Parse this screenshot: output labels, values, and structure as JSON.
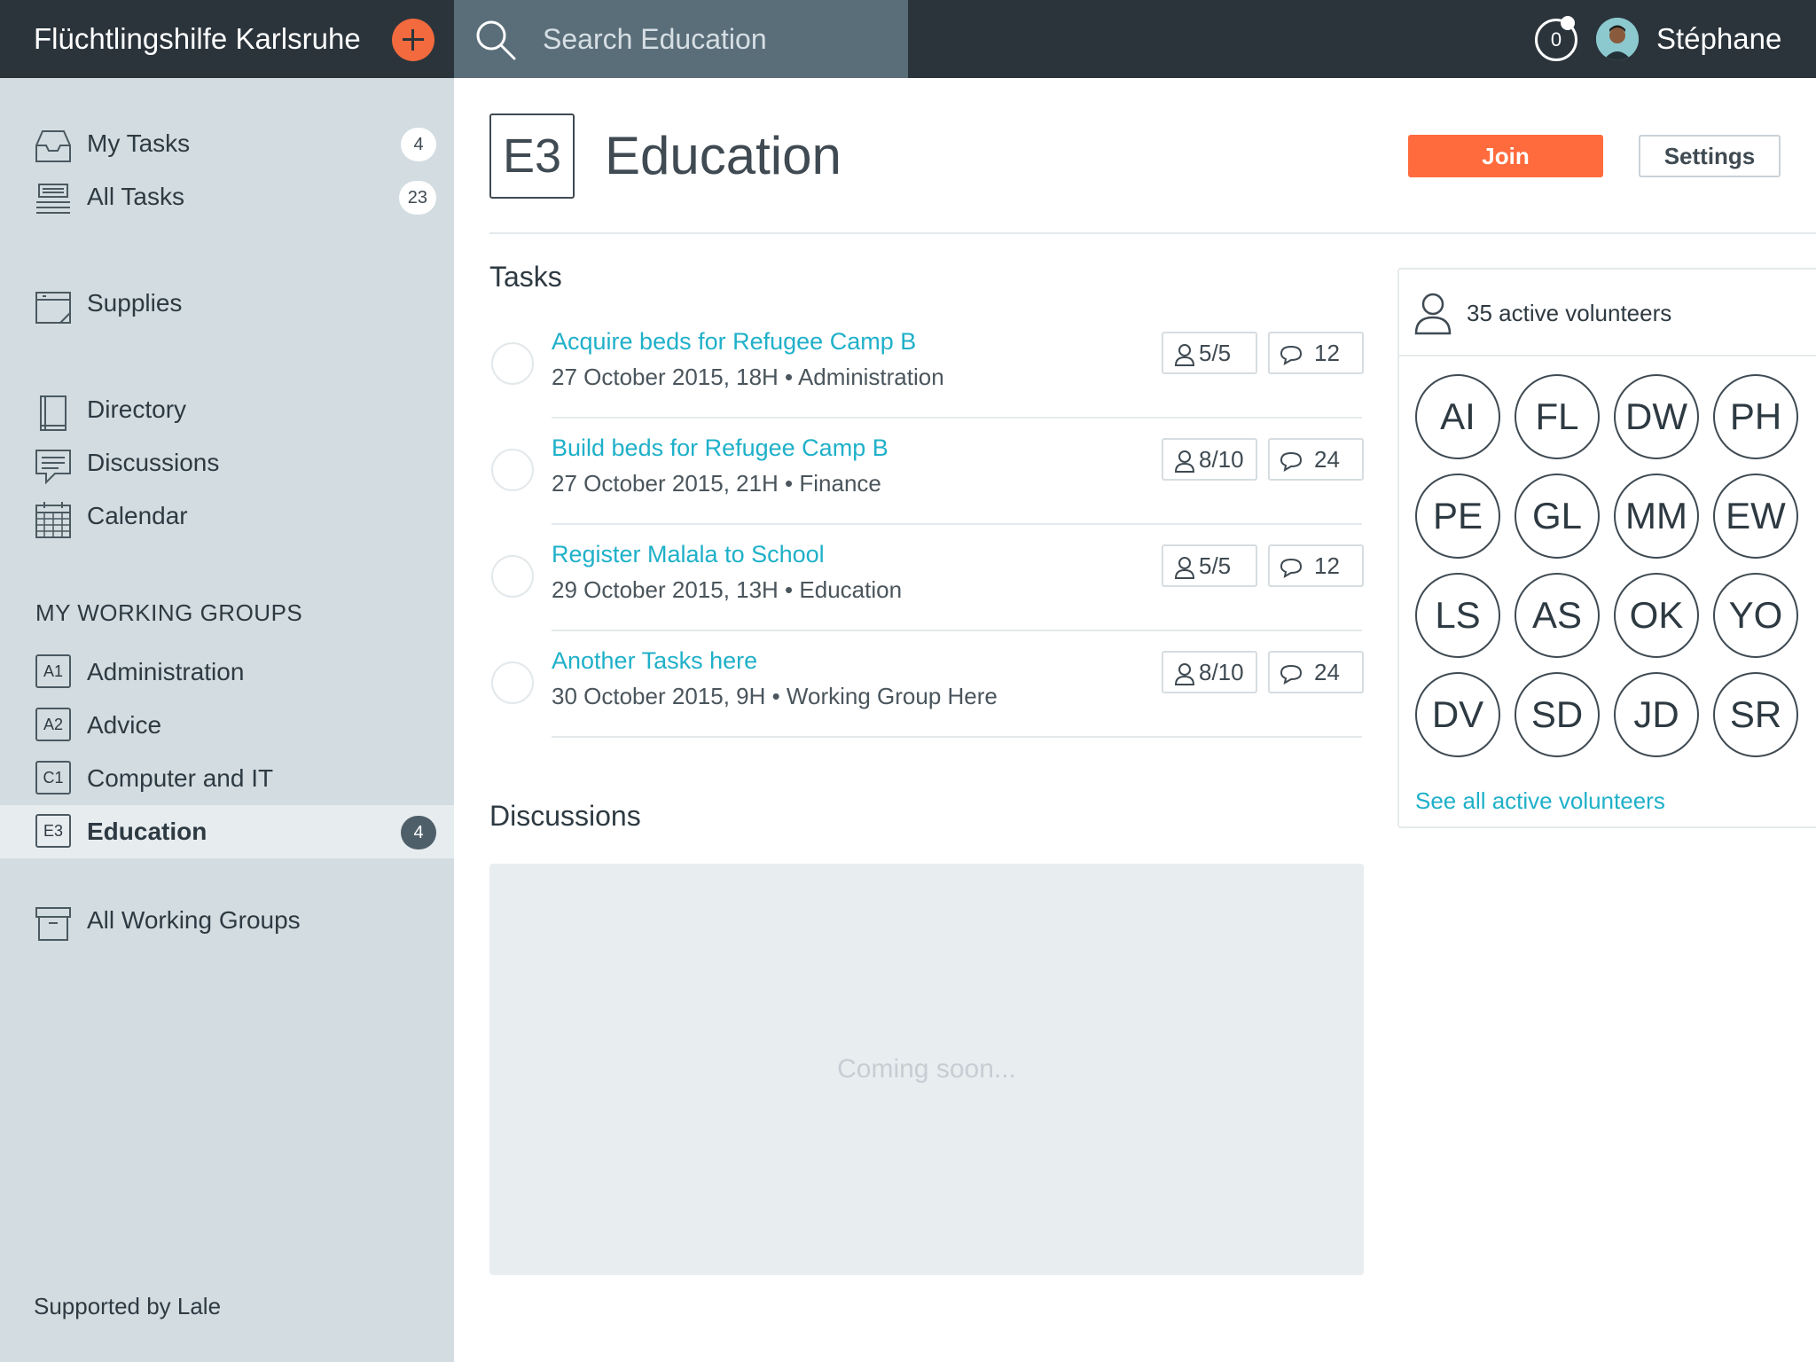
{
  "app": {
    "org_name": "Flüchtlingshilfe Karlsruhe",
    "search_placeholder": "Search Education",
    "notifications": "0",
    "user_name": "Stéphane"
  },
  "sidebar": {
    "items": [
      {
        "label": "My Tasks",
        "count": "4",
        "icon": "inbox-icon"
      },
      {
        "label": "All Tasks",
        "count": "23",
        "icon": "stack-icon"
      },
      {
        "label": "Supplies",
        "icon": "supplies-icon"
      },
      {
        "label": "Directory",
        "icon": "book-icon"
      },
      {
        "label": "Discussions",
        "icon": "chat-icon"
      },
      {
        "label": "Calendar",
        "icon": "calendar-icon"
      }
    ],
    "groups_heading": "MY WORKING GROUPS",
    "groups": [
      {
        "code": "A1",
        "label": "Administration"
      },
      {
        "code": "A2",
        "label": "Advice"
      },
      {
        "code": "C1",
        "label": "Computer and IT"
      },
      {
        "code": "E3",
        "label": "Education",
        "count": "4",
        "active": true
      }
    ],
    "all_groups": "All Working Groups",
    "footer": "Supported by Lale"
  },
  "page": {
    "code": "E3",
    "title": "Education",
    "join_label": "Join",
    "settings_label": "Settings"
  },
  "tasks": {
    "heading": "Tasks",
    "items": [
      {
        "title": "Acquire beds for Refugee Camp B",
        "meta": "27 October 2015, 18H • Administration",
        "people": "5/5",
        "comments": "12"
      },
      {
        "title": "Build beds for Refugee Camp B",
        "meta": "27 October 2015, 21H • Finance",
        "people": "8/10",
        "comments": "24"
      },
      {
        "title": "Register Malala to School",
        "meta": "29 October 2015, 13H • Education",
        "people": "5/5",
        "comments": "12"
      },
      {
        "title": "Another Tasks here",
        "meta": "30 October 2015, 9H • Working Group Here",
        "people": "8/10",
        "comments": "24"
      }
    ]
  },
  "discussions": {
    "heading": "Discussions",
    "placeholder": "Coming soon..."
  },
  "volunteers": {
    "count_label": "35 active volunteers",
    "initials": [
      "AI",
      "FL",
      "DW",
      "PH",
      "PE",
      "GL",
      "MM",
      "EW",
      "LS",
      "AS",
      "OK",
      "YO",
      "DV",
      "SD",
      "JD",
      "SR"
    ],
    "see_all": "See all active volunteers"
  },
  "colors": {
    "topbar": "#2b343b",
    "sidebar": "#d2dce1",
    "accent": "#ff6b3d",
    "link": "#1fb0c9"
  }
}
